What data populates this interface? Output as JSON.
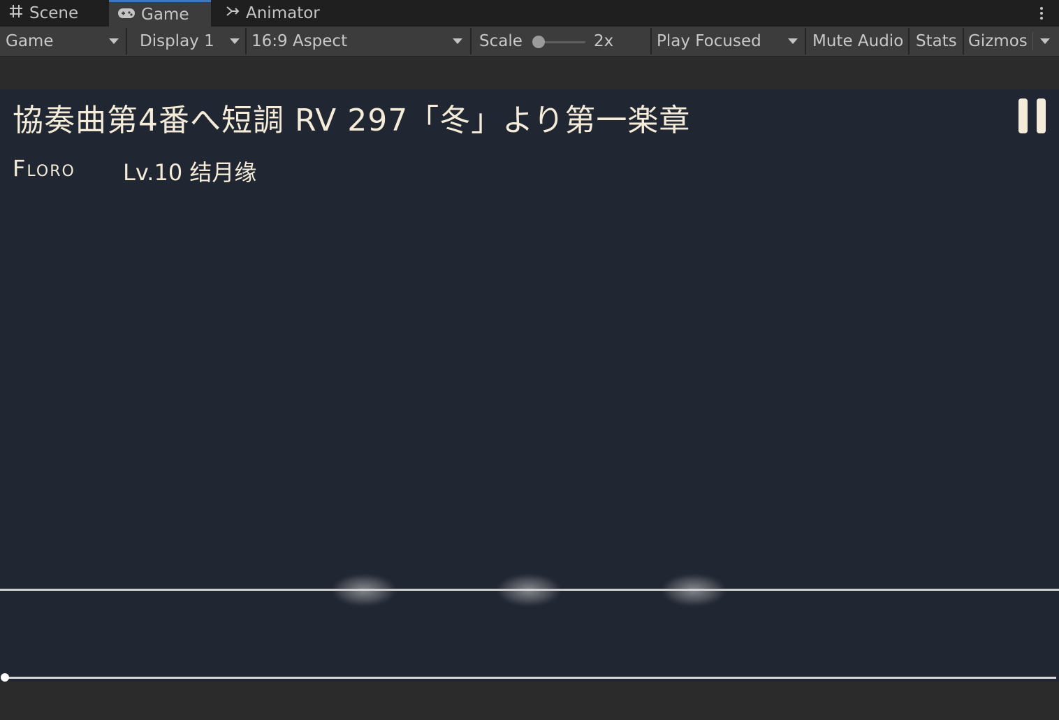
{
  "tabs": [
    {
      "label": "Scene",
      "icon": "grid-hash-icon"
    },
    {
      "label": "Game",
      "icon": "gamepad-icon",
      "active": true
    },
    {
      "label": "Animator",
      "icon": "animator-branch-icon"
    }
  ],
  "toolbar": {
    "view_select": "Game",
    "display_select": "Display 1",
    "aspect_select": "16:9 Aspect",
    "scale_label": "Scale",
    "scale_value": "2x",
    "play_mode_select": "Play Focused",
    "mute_audio": "Mute Audio",
    "stats": "Stats",
    "gizmos": "Gizmos"
  },
  "game": {
    "song_title": "協奏曲第4番へ短調 RV 297「冬」より第一楽章",
    "player_name": "Floro",
    "level": "Lv.10 结月缘",
    "progress": 0.0,
    "colors": {
      "background": "#202632",
      "text": "#f4ecd8",
      "line": "#cfcfcf"
    }
  }
}
